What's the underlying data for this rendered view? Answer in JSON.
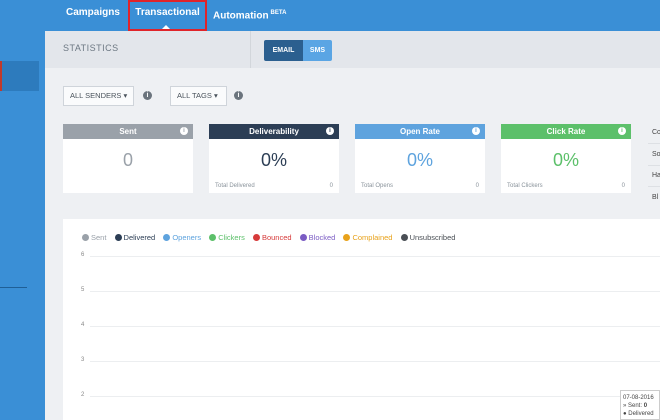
{
  "nav": {
    "campaigns": "Campaigns",
    "transactional": "Transactional",
    "automation": "Automation",
    "automation_badge": "BETA"
  },
  "stats": {
    "title": "STATISTICS",
    "toggle_email": "EMAIL",
    "toggle_sms": "SMS",
    "filter_senders": "ALL SENDERS ▾",
    "filter_tags": "ALL TAGS ▾",
    "info_glyph": "i"
  },
  "cards": [
    {
      "title": "Sent",
      "value": "0",
      "foot_label": "",
      "foot_value": "",
      "color": "#9aa1a9",
      "value_color": "#9aa1a9"
    },
    {
      "title": "Deliverability",
      "value": "0%",
      "foot_label": "Total Delivered",
      "foot_value": "0",
      "color": "#2c3e55",
      "value_color": "#2c3e55"
    },
    {
      "title": "Open Rate",
      "value": "0%",
      "foot_label": "Total Opens",
      "foot_value": "0",
      "color": "#5ea3de",
      "value_color": "#5ea3de"
    },
    {
      "title": "Click Rate",
      "value": "0%",
      "foot_label": "Total Clickers",
      "foot_value": "0",
      "color": "#5cc06a",
      "value_color": "#5cc06a"
    }
  ],
  "side_list": [
    "Co",
    "So",
    "Ha",
    "Bl"
  ],
  "legend": [
    {
      "label": "Sent",
      "color": "#9aa1a9"
    },
    {
      "label": "Delivered",
      "color": "#2c3e55"
    },
    {
      "label": "Openers",
      "color": "#5ea3de"
    },
    {
      "label": "Clickers",
      "color": "#5cc06a"
    },
    {
      "label": "Bounced",
      "color": "#d63a3a"
    },
    {
      "label": "Blocked",
      "color": "#7b5cc4"
    },
    {
      "label": "Complained",
      "color": "#e8a21b"
    },
    {
      "label": "Unsubscribed",
      "color": "#4a4f55"
    }
  ],
  "y_ticks": [
    "6",
    "5",
    "4",
    "3",
    "2"
  ],
  "tooltip": {
    "date": "07-08-2016",
    "sent_label": "» Sent: ",
    "sent_value": "0",
    "delivered_label": "● Delivered"
  }
}
